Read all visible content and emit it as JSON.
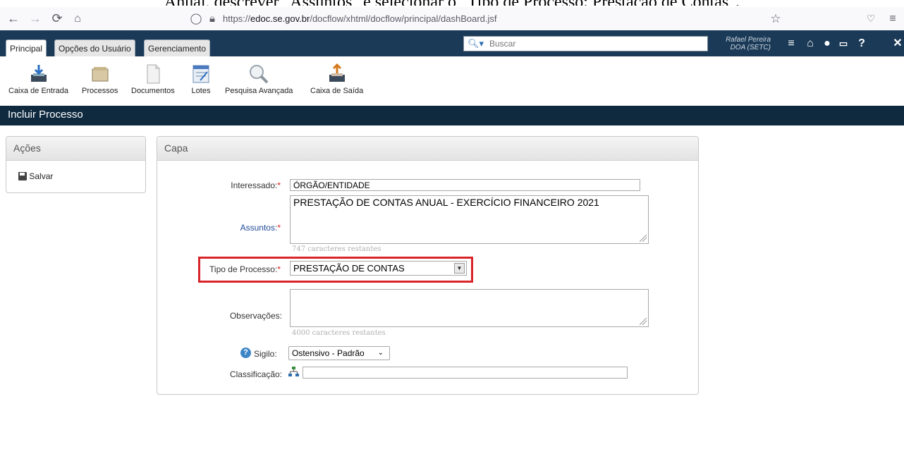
{
  "caption": "Anual, descrever \"Assuntos\" e selecionar o \"Tipo de Processo: Prestação de Contas\".",
  "browser": {
    "url_prefix": "https://",
    "url_domain": "edoc.se.gov.br",
    "url_path": "/docflow/xhtml/docflow/principal/dashBoard.jsf"
  },
  "tabs": [
    {
      "label": "Principal",
      "active": true
    },
    {
      "label": "Opções do Usuário",
      "active": false
    },
    {
      "label": "Gerenciamento",
      "active": false
    }
  ],
  "search": {
    "placeholder": "Buscar"
  },
  "user": {
    "name": "Rafael Pereira",
    "unit": "DOA (SETC)"
  },
  "toolbar": [
    {
      "label": "Caixa de Entrada",
      "icon": "inbox-icon"
    },
    {
      "label": "Processos",
      "icon": "folder-icon"
    },
    {
      "label": "Documentos",
      "icon": "document-icon"
    },
    {
      "label": "Lotes",
      "icon": "batch-icon"
    },
    {
      "label": "Pesquisa Avançada",
      "icon": "magnifier-icon"
    },
    {
      "label": "Caixa de Saída",
      "icon": "outbox-icon"
    }
  ],
  "page_title": "Incluir Processo",
  "actions": {
    "title": "Ações",
    "save_label": "Salvar"
  },
  "form": {
    "title": "Capa",
    "interessado_label": "Interessado:",
    "interessado_value": "ÓRGÃO/ENTIDADE",
    "assuntos_label": "Assuntos:",
    "assuntos_value": "PRESTAÇÃO DE CONTAS ANUAL - EXERCÍCIO FINANCEIRO 2021",
    "assuntos_hint": "747 caracteres restantes",
    "tipo_label": "Tipo de Processo:",
    "tipo_value": "PRESTAÇÃO DE CONTAS",
    "observacoes_label": "Observações:",
    "observacoes_value": "",
    "observacoes_hint": "4000 caracteres restantes",
    "sigilo_label": "Sigilo:",
    "sigilo_value": "Ostensivo - Padrão",
    "classificacao_label": "Classificação:",
    "classificacao_value": "",
    "required_mark": "*"
  },
  "colors": {
    "highlight": "#d9252a",
    "topbar": "#1b3a57",
    "titlebar": "#0f2a3f"
  }
}
